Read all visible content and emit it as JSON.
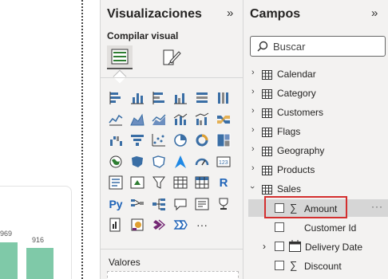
{
  "visualizations": {
    "title": "Visualizaciones",
    "collapse_glyph": "»",
    "build_label": "Compilar visual",
    "values_label": "Valores",
    "icons": [
      "stacked-bar-icon",
      "stacked-column-icon",
      "clustered-bar-icon",
      "clustered-column-icon",
      "100-stacked-bar-icon",
      "100-stacked-column-icon",
      "line-chart-icon",
      "area-chart-icon",
      "stacked-area-icon",
      "line-column-icon",
      "line-clustered-column-icon",
      "ribbon-chart-icon",
      "waterfall-icon",
      "funnel-icon",
      "scatter-icon",
      "pie-icon",
      "donut-icon",
      "treemap-icon",
      "map-icon",
      "filled-map-icon",
      "shape-map-icon",
      "azure-map-icon",
      "gauge-icon",
      "card-icon",
      "multirow-card-icon",
      "kpi-icon",
      "slicer-icon",
      "table-icon",
      "matrix-icon",
      "r-visual-icon",
      "python-visual-icon",
      "key-influencers-icon",
      "decomposition-tree-icon",
      "qa-icon",
      "smart-narrative-icon",
      "goals-icon",
      "paginated-report-icon",
      "power-apps-icon",
      "power-automate-icon",
      "get-more-visuals-icon",
      "more-options-icon"
    ]
  },
  "fields": {
    "title": "Campos",
    "collapse_glyph": "»",
    "search_placeholder": "Buscar",
    "tables": [
      {
        "name": "Calendar"
      },
      {
        "name": "Category"
      },
      {
        "name": "Customers"
      },
      {
        "name": "Flags"
      },
      {
        "name": "Geography"
      },
      {
        "name": "Products"
      },
      {
        "name": "Sales"
      }
    ],
    "sales_fields": [
      {
        "name": "Amount",
        "type": "measure",
        "highlighted": true
      },
      {
        "name": "Customer Id",
        "type": "column"
      },
      {
        "name": "Delivery Date",
        "type": "date"
      },
      {
        "name": "Discount",
        "type": "measure"
      }
    ],
    "more_glyph": "···"
  },
  "canvas": {
    "bar_labels": [
      "969",
      "916"
    ],
    "bar_color": "#7fc9a8"
  },
  "colors": {
    "pane_bg": "#f3f2f1",
    "highlight_border": "#d32f2f",
    "selected_row": "#d6d6d6"
  }
}
